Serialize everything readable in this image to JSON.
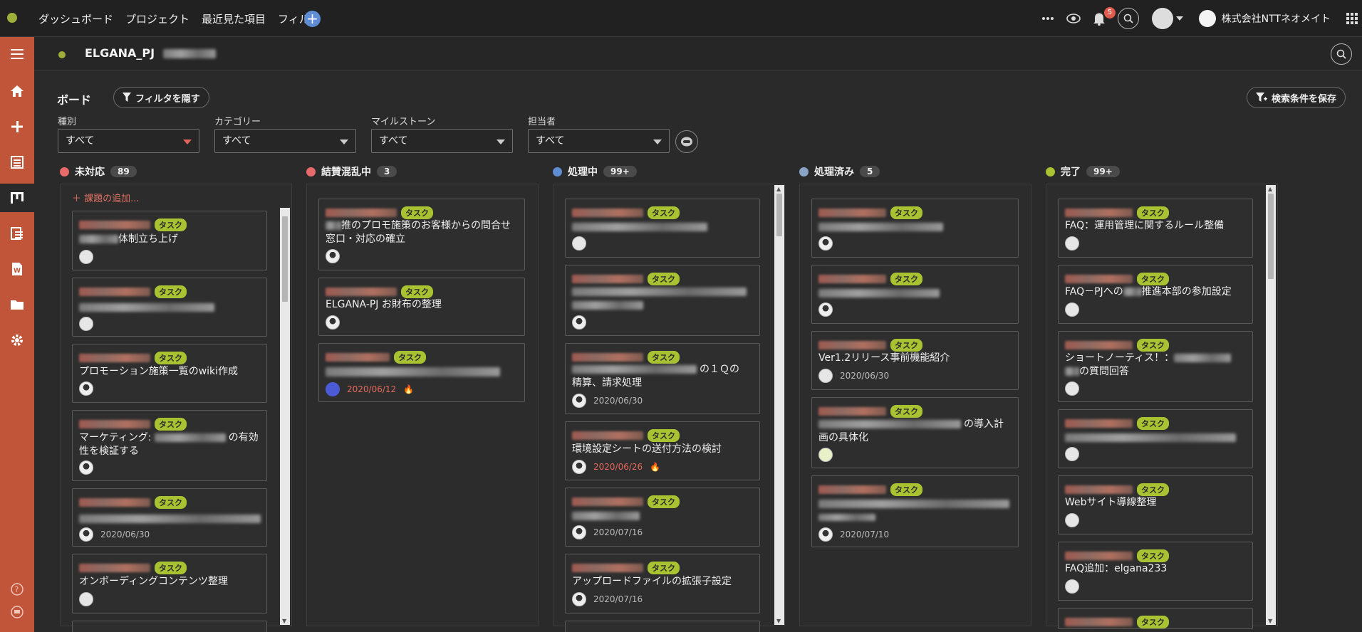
{
  "topbar": {
    "nav": [
      "ダッシュボード",
      "プロジェクト",
      "最近見た項目",
      "フィルタ"
    ],
    "plus": "+",
    "notification_count": "5",
    "org_name": "株式会社NTTネオメイト"
  },
  "project": {
    "name": "ELGANA_PJ"
  },
  "board": {
    "title": "ボード",
    "hide_filter_label": "フィルタを隠す",
    "save_search_label": "検索条件を保存",
    "filters": [
      {
        "label": "種別",
        "value": "すべて"
      },
      {
        "label": "カテゴリー",
        "value": "すべて"
      },
      {
        "label": "マイルストーン",
        "value": "すべて"
      },
      {
        "label": "担当者",
        "value": "すべて"
      }
    ],
    "add_issue": "課題の追加...",
    "columns": [
      {
        "name": "未対応",
        "count": "89",
        "color": "#e86a6a"
      },
      {
        "name": "結賛混乱中",
        "count": "3",
        "color": "#e86a6a"
      },
      {
        "name": "処理中",
        "count": "99+",
        "color": "#5f8dd3"
      },
      {
        "name": "処理済み",
        "count": "5",
        "color": "#8aa4c8"
      },
      {
        "name": "完了",
        "count": "99+",
        "color": "#a8c232"
      }
    ],
    "tag_label": "タスク",
    "cards": {
      "c0": [
        "体制立ち上げ",
        "",
        "プロモーション施策一覧のwiki作成",
        "マーケティング:",
        "の有効性を検証する",
        "",
        "オンボーディングコンテンツ整理"
      ],
      "c0_dates": [
        "2020/06/30"
      ],
      "c1": [
        "推のプロモ施策のお客様からの問合せ窓口・対応の確立",
        "ELGANA-PJ お財布の整理"
      ],
      "c1_dates": [
        "2020/06/12"
      ],
      "c2": [
        "の１Ｑの",
        "精算、請求処理",
        "環境設定シートの送付方法の検討",
        "アップロードファイルの拡張子設定"
      ],
      "c2_dates": [
        "2020/06/30",
        "2020/06/26",
        "2020/07/16",
        "2020/07/16"
      ],
      "c3": [
        "Ver1.2リリース事前機能紹介",
        "の導入計",
        "画の具体化"
      ],
      "c3_dates": [
        "2020/06/30",
        "2020/07/10"
      ],
      "c4": [
        "FAQ：運用管理に関するルール整備",
        "FAQ－PJへの",
        "推進本部の参加設定",
        "ショートノーティス！：",
        "の質問回答",
        "Webサイト導線整理",
        "FAQ追加：elgana233"
      ]
    }
  }
}
